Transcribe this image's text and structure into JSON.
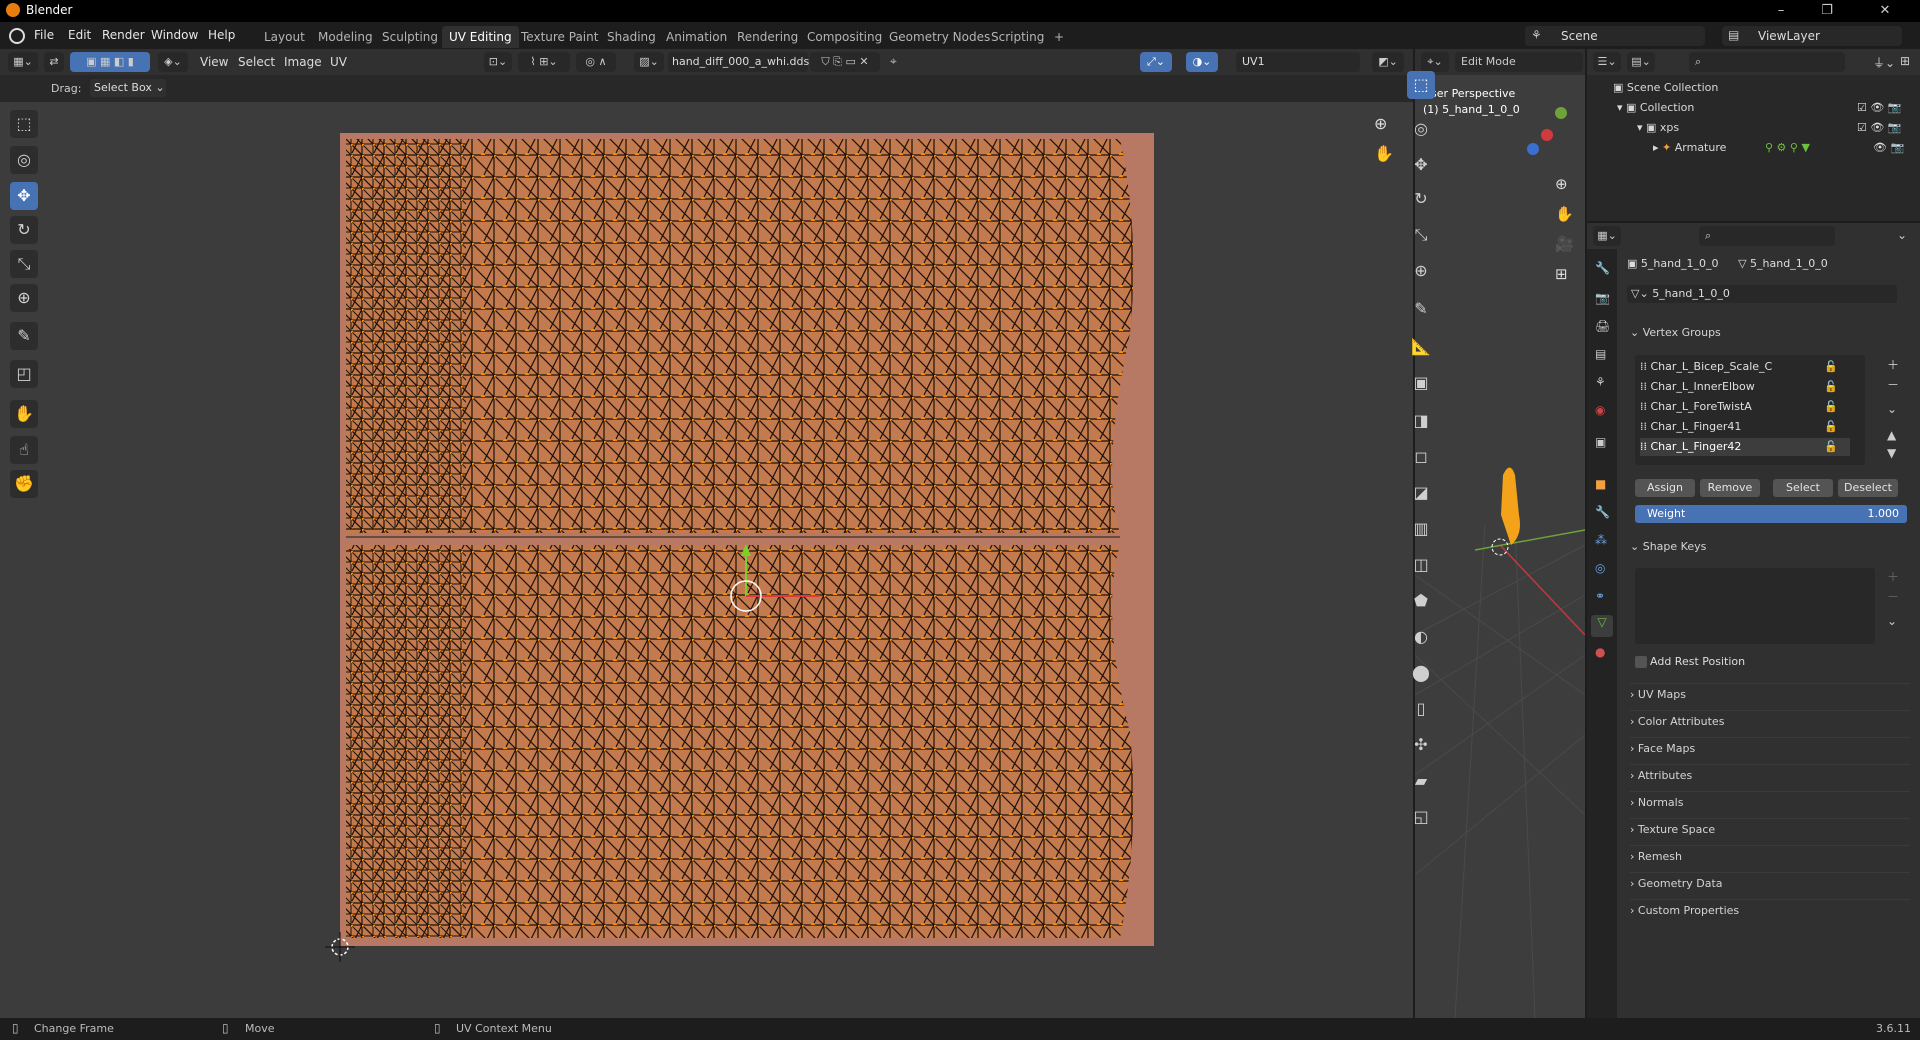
{
  "app": {
    "title": "Blender",
    "version": "3.6.11"
  },
  "menu": [
    "File",
    "Edit",
    "Render",
    "Window",
    "Help"
  ],
  "workspaces": [
    "Layout",
    "Modeling",
    "Sculpting",
    "UV Editing",
    "Texture Paint",
    "Shading",
    "Animation",
    "Rendering",
    "Compositing",
    "Geometry Nodes",
    "Scripting",
    "+"
  ],
  "active_workspace": "UV Editing",
  "scene": {
    "label": "Scene",
    "view_layer": "ViewLayer"
  },
  "uv_editor": {
    "menus": [
      "View",
      "Select",
      "Image",
      "UV"
    ],
    "image_name": "hand_diff_000_a_whi.dds",
    "uv_map": "UV1",
    "drag_label": "Drag:",
    "drag_value": "Select Box"
  },
  "viewport": {
    "mode": "Edit Mode",
    "view_label": "User Perspective",
    "object_label": "(1) 5_hand_1_0_0"
  },
  "outliner": {
    "scene_collection": "Scene Collection",
    "collection": "Collection",
    "xps": "xps",
    "armature": "Armature"
  },
  "properties": {
    "object_name": "5_hand_1_0_0",
    "data_name": "5_hand_1_0_0",
    "mesh_name": "5_hand_1_0_0",
    "vertex_groups_title": "Vertex Groups",
    "vertex_groups": [
      "Char_L_Bicep_Scale_C",
      "Char_L_InnerElbow",
      "Char_L_ForeTwistA",
      "Char_L_Finger41",
      "Char_L_Finger42"
    ],
    "active_group": "Char_L_Finger42",
    "buttons": {
      "assign": "Assign",
      "remove": "Remove",
      "select": "Select",
      "deselect": "Deselect"
    },
    "weight_label": "Weight",
    "weight_value": "1.000",
    "shape_keys_title": "Shape Keys",
    "add_rest_position": "Add Rest Position",
    "sections": [
      "UV Maps",
      "Color Attributes",
      "Face Maps",
      "Attributes",
      "Normals",
      "Texture Space",
      "Remesh",
      "Geometry Data",
      "Custom Properties"
    ]
  },
  "statusbar": {
    "left": "Change Frame",
    "middle": "Move",
    "right": "UV Context Menu"
  },
  "colors": {
    "accent": "#4772b3",
    "uv_face": "#c47a4f",
    "vertex": "#ff8c00",
    "edge": "#111111"
  }
}
